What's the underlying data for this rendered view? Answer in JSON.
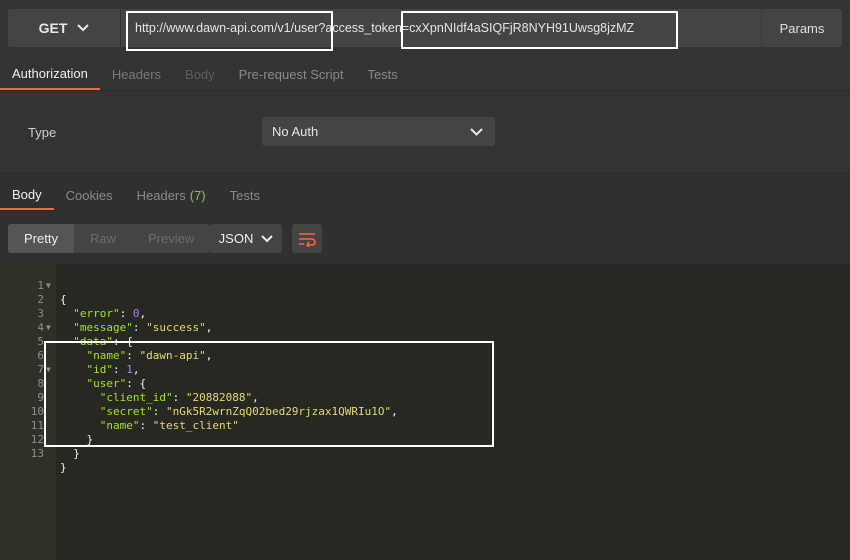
{
  "request": {
    "method": "GET",
    "url": "http://www.dawn-api.com/v1/user?access_token=cxXpnNIdf4aSIQFjR8NYH91Uwsg8jzMZ",
    "params_label": "Params"
  },
  "request_tabs": [
    "Authorization",
    "Headers",
    "Body",
    "Pre-request Script",
    "Tests"
  ],
  "auth": {
    "type_label": "Type",
    "type_value": "No Auth"
  },
  "response_tabs": {
    "body": "Body",
    "cookies": "Cookies",
    "headers": "Headers",
    "headers_count": "(7)",
    "tests": "Tests"
  },
  "view_modes": [
    "Pretty",
    "Raw",
    "Preview"
  ],
  "format": "JSON",
  "line_numbers": [
    "1",
    "2",
    "3",
    "4",
    "5",
    "6",
    "7",
    "8",
    "9",
    "10",
    "11",
    "12",
    "13"
  ],
  "json": {
    "error_key": "\"error\"",
    "error_val": "0",
    "message_key": "\"message\"",
    "message_val": "\"success\"",
    "data_key": "\"data\"",
    "name_key": "\"name\"",
    "name_val": "\"dawn-api\"",
    "id_key": "\"id\"",
    "id_val": "1",
    "user_key": "\"user\"",
    "client_id_key": "\"client_id\"",
    "client_id_val": "\"20882088\"",
    "secret_key": "\"secret\"",
    "secret_val": "\"nGk5R2wrnZqQ02bed29rjzax1QWRIu1O\"",
    "uname_key": "\"name\"",
    "uname_val": "\"test_client\""
  },
  "colors": {
    "accent": "#f26b3a",
    "count": "#7ec850",
    "editor_bg": "#272822"
  }
}
